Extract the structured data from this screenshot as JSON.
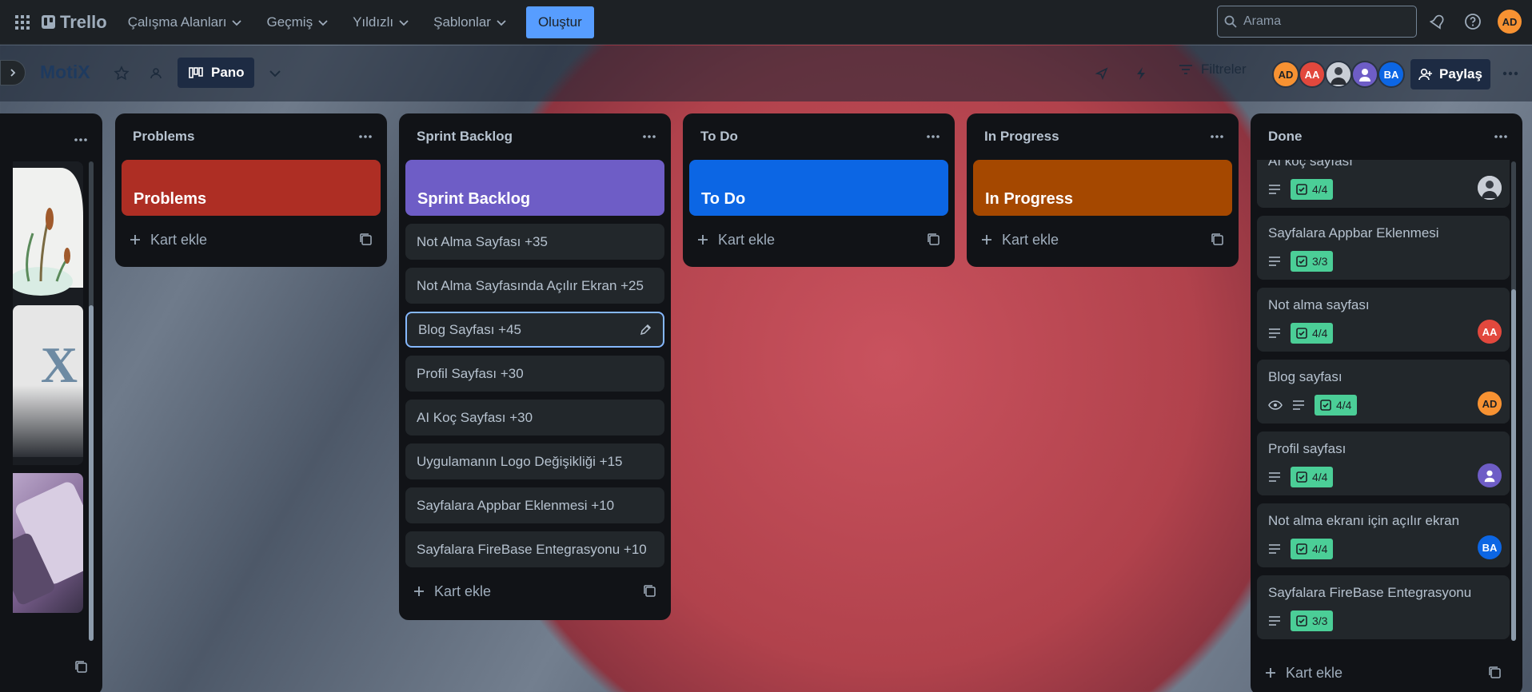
{
  "topbar": {
    "app_name": "Trello",
    "menus": [
      "Çalışma Alanları",
      "Geçmiş",
      "Yıldızlı",
      "Şablonlar"
    ],
    "create_label": "Oluştur",
    "search_placeholder": "Arama",
    "user_initials": "AD"
  },
  "board": {
    "title": "MotiX",
    "view_label": "Pano",
    "filters_label": "Filtreler",
    "share_label": "Paylaş",
    "members": [
      "AD",
      "AA",
      "",
      "",
      "BA"
    ]
  },
  "lists": {
    "problems": {
      "title": "Problems",
      "cover": "Problems",
      "add": "Kart ekle"
    },
    "sprint": {
      "title": "Sprint Backlog",
      "cover": "Sprint Backlog",
      "cards": [
        "Not Alma Sayfası +35",
        "Not Alma Sayfasında Açılır Ekran +25",
        "Blog Sayfası +45",
        "Profil Sayfası +30",
        "AI Koç Sayfası +30",
        "Uygulamanın Logo Değişikliği +15",
        "Sayfalara Appbar Eklenmesi +10",
        "Sayfalara FireBase Entegrasyonu +10"
      ],
      "add": "Kart ekle"
    },
    "todo": {
      "title": "To Do",
      "cover": "To Do",
      "add": "Kart ekle"
    },
    "inprogress": {
      "title": "In Progress",
      "cover": "In Progress",
      "add": "Kart ekle"
    },
    "done": {
      "title": "Done",
      "cards": [
        {
          "title": "AI koç sayfası",
          "check": "4/4",
          "member": ""
        },
        {
          "title": "Sayfalara Appbar Eklenmesi",
          "check": "3/3",
          "member": ""
        },
        {
          "title": "Not alma sayfası",
          "check": "4/4",
          "member": "AA"
        },
        {
          "title": "Blog sayfası",
          "check": "4/4",
          "member": "AD"
        },
        {
          "title": "Profil sayfası",
          "check": "4/4",
          "member": ""
        },
        {
          "title": "Not alma ekranı için açılır ekran",
          "check": "4/4",
          "member": "BA"
        },
        {
          "title": "Sayfalara FireBase Entegrasyonu",
          "check": "3/3",
          "member": ""
        }
      ],
      "add": "Kart ekle"
    }
  },
  "colors": {
    "problems": "#ae2e24",
    "sprint": "#6e5dc6",
    "todo": "#0c66e4",
    "inprogress": "#a54800",
    "check": "#4bce97",
    "AD": "#f79232",
    "AA": "#e2483d",
    "BA": "#0c66e4",
    "purple": "#6e5dc6"
  }
}
